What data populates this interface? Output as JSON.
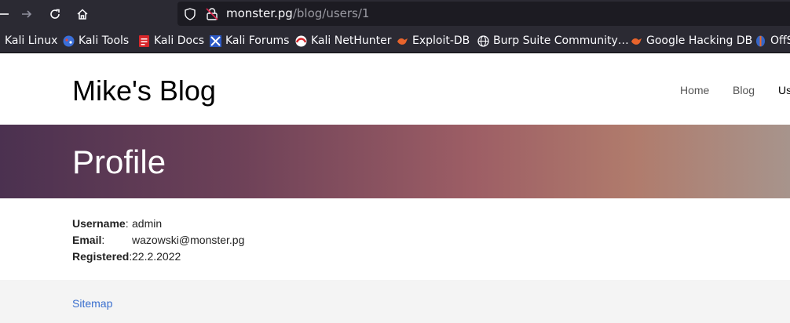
{
  "browser": {
    "url_host": "monster.pg",
    "url_path": "/blog/users/1",
    "bookmarks": [
      {
        "label": "Kali Linux",
        "icon": "kali-linux-icon"
      },
      {
        "label": "Kali Tools",
        "icon": "kali-tools-icon"
      },
      {
        "label": "Kali Docs",
        "icon": "kali-docs-icon"
      },
      {
        "label": "Kali Forums",
        "icon": "kali-forums-icon"
      },
      {
        "label": "Kali NetHunter",
        "icon": "kali-nethunter-icon"
      },
      {
        "label": "Exploit-DB",
        "icon": "exploit-db-icon"
      },
      {
        "label": "Burp Suite Community…",
        "icon": "globe-icon"
      },
      {
        "label": "Google Hacking DB",
        "icon": "exploit-db-icon"
      },
      {
        "label": "OffS",
        "icon": "offsec-icon"
      }
    ]
  },
  "site": {
    "title": "Mike's Blog",
    "nav": [
      {
        "label": "Home"
      },
      {
        "label": "Blog"
      },
      {
        "label": "Us"
      }
    ]
  },
  "hero": {
    "title": "Profile"
  },
  "profile": {
    "rows": [
      {
        "label": "Username",
        "sep": ":",
        "value": "admin"
      },
      {
        "label": "Email",
        "sep": ":",
        "value": "wazowski@monster.pg"
      },
      {
        "label": "Registered",
        "sep": ":",
        "value": "22.2.2022"
      }
    ]
  },
  "footer": {
    "sitemap": "Sitemap"
  },
  "colors": {
    "toolbar": "#2b2a33",
    "urlbar": "#1c1b22",
    "link": "#3a6fce",
    "footer_bg": "#f4f4f4"
  }
}
